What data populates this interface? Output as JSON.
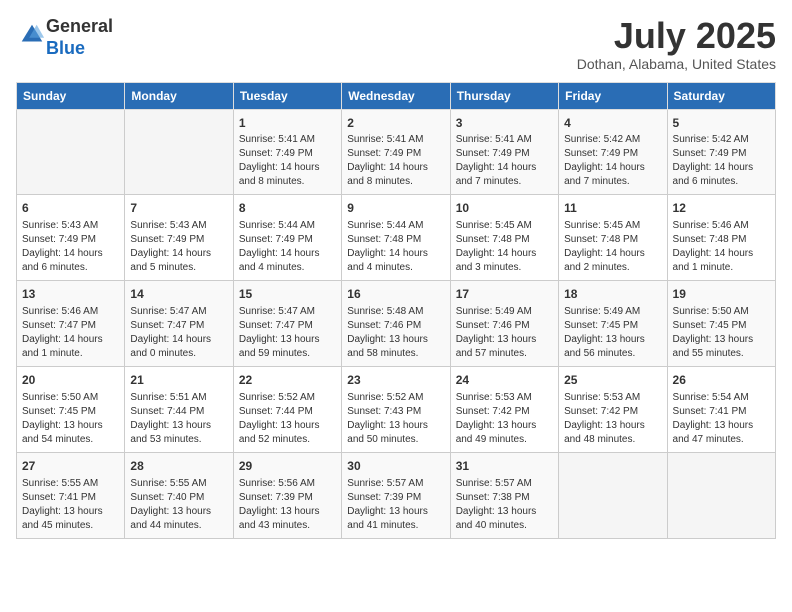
{
  "logo": {
    "general": "General",
    "blue": "Blue"
  },
  "header": {
    "month": "July 2025",
    "location": "Dothan, Alabama, United States"
  },
  "weekdays": [
    "Sunday",
    "Monday",
    "Tuesday",
    "Wednesday",
    "Thursday",
    "Friday",
    "Saturday"
  ],
  "weeks": [
    [
      {
        "day": "",
        "sunrise": "",
        "sunset": "",
        "daylight": ""
      },
      {
        "day": "",
        "sunrise": "",
        "sunset": "",
        "daylight": ""
      },
      {
        "day": "1",
        "sunrise": "Sunrise: 5:41 AM",
        "sunset": "Sunset: 7:49 PM",
        "daylight": "Daylight: 14 hours and 8 minutes."
      },
      {
        "day": "2",
        "sunrise": "Sunrise: 5:41 AM",
        "sunset": "Sunset: 7:49 PM",
        "daylight": "Daylight: 14 hours and 8 minutes."
      },
      {
        "day": "3",
        "sunrise": "Sunrise: 5:41 AM",
        "sunset": "Sunset: 7:49 PM",
        "daylight": "Daylight: 14 hours and 7 minutes."
      },
      {
        "day": "4",
        "sunrise": "Sunrise: 5:42 AM",
        "sunset": "Sunset: 7:49 PM",
        "daylight": "Daylight: 14 hours and 7 minutes."
      },
      {
        "day": "5",
        "sunrise": "Sunrise: 5:42 AM",
        "sunset": "Sunset: 7:49 PM",
        "daylight": "Daylight: 14 hours and 6 minutes."
      }
    ],
    [
      {
        "day": "6",
        "sunrise": "Sunrise: 5:43 AM",
        "sunset": "Sunset: 7:49 PM",
        "daylight": "Daylight: 14 hours and 6 minutes."
      },
      {
        "day": "7",
        "sunrise": "Sunrise: 5:43 AM",
        "sunset": "Sunset: 7:49 PM",
        "daylight": "Daylight: 14 hours and 5 minutes."
      },
      {
        "day": "8",
        "sunrise": "Sunrise: 5:44 AM",
        "sunset": "Sunset: 7:49 PM",
        "daylight": "Daylight: 14 hours and 4 minutes."
      },
      {
        "day": "9",
        "sunrise": "Sunrise: 5:44 AM",
        "sunset": "Sunset: 7:48 PM",
        "daylight": "Daylight: 14 hours and 4 minutes."
      },
      {
        "day": "10",
        "sunrise": "Sunrise: 5:45 AM",
        "sunset": "Sunset: 7:48 PM",
        "daylight": "Daylight: 14 hours and 3 minutes."
      },
      {
        "day": "11",
        "sunrise": "Sunrise: 5:45 AM",
        "sunset": "Sunset: 7:48 PM",
        "daylight": "Daylight: 14 hours and 2 minutes."
      },
      {
        "day": "12",
        "sunrise": "Sunrise: 5:46 AM",
        "sunset": "Sunset: 7:48 PM",
        "daylight": "Daylight: 14 hours and 1 minute."
      }
    ],
    [
      {
        "day": "13",
        "sunrise": "Sunrise: 5:46 AM",
        "sunset": "Sunset: 7:47 PM",
        "daylight": "Daylight: 14 hours and 1 minute."
      },
      {
        "day": "14",
        "sunrise": "Sunrise: 5:47 AM",
        "sunset": "Sunset: 7:47 PM",
        "daylight": "Daylight: 14 hours and 0 minutes."
      },
      {
        "day": "15",
        "sunrise": "Sunrise: 5:47 AM",
        "sunset": "Sunset: 7:47 PM",
        "daylight": "Daylight: 13 hours and 59 minutes."
      },
      {
        "day": "16",
        "sunrise": "Sunrise: 5:48 AM",
        "sunset": "Sunset: 7:46 PM",
        "daylight": "Daylight: 13 hours and 58 minutes."
      },
      {
        "day": "17",
        "sunrise": "Sunrise: 5:49 AM",
        "sunset": "Sunset: 7:46 PM",
        "daylight": "Daylight: 13 hours and 57 minutes."
      },
      {
        "day": "18",
        "sunrise": "Sunrise: 5:49 AM",
        "sunset": "Sunset: 7:45 PM",
        "daylight": "Daylight: 13 hours and 56 minutes."
      },
      {
        "day": "19",
        "sunrise": "Sunrise: 5:50 AM",
        "sunset": "Sunset: 7:45 PM",
        "daylight": "Daylight: 13 hours and 55 minutes."
      }
    ],
    [
      {
        "day": "20",
        "sunrise": "Sunrise: 5:50 AM",
        "sunset": "Sunset: 7:45 PM",
        "daylight": "Daylight: 13 hours and 54 minutes."
      },
      {
        "day": "21",
        "sunrise": "Sunrise: 5:51 AM",
        "sunset": "Sunset: 7:44 PM",
        "daylight": "Daylight: 13 hours and 53 minutes."
      },
      {
        "day": "22",
        "sunrise": "Sunrise: 5:52 AM",
        "sunset": "Sunset: 7:44 PM",
        "daylight": "Daylight: 13 hours and 52 minutes."
      },
      {
        "day": "23",
        "sunrise": "Sunrise: 5:52 AM",
        "sunset": "Sunset: 7:43 PM",
        "daylight": "Daylight: 13 hours and 50 minutes."
      },
      {
        "day": "24",
        "sunrise": "Sunrise: 5:53 AM",
        "sunset": "Sunset: 7:42 PM",
        "daylight": "Daylight: 13 hours and 49 minutes."
      },
      {
        "day": "25",
        "sunrise": "Sunrise: 5:53 AM",
        "sunset": "Sunset: 7:42 PM",
        "daylight": "Daylight: 13 hours and 48 minutes."
      },
      {
        "day": "26",
        "sunrise": "Sunrise: 5:54 AM",
        "sunset": "Sunset: 7:41 PM",
        "daylight": "Daylight: 13 hours and 47 minutes."
      }
    ],
    [
      {
        "day": "27",
        "sunrise": "Sunrise: 5:55 AM",
        "sunset": "Sunset: 7:41 PM",
        "daylight": "Daylight: 13 hours and 45 minutes."
      },
      {
        "day": "28",
        "sunrise": "Sunrise: 5:55 AM",
        "sunset": "Sunset: 7:40 PM",
        "daylight": "Daylight: 13 hours and 44 minutes."
      },
      {
        "day": "29",
        "sunrise": "Sunrise: 5:56 AM",
        "sunset": "Sunset: 7:39 PM",
        "daylight": "Daylight: 13 hours and 43 minutes."
      },
      {
        "day": "30",
        "sunrise": "Sunrise: 5:57 AM",
        "sunset": "Sunset: 7:39 PM",
        "daylight": "Daylight: 13 hours and 41 minutes."
      },
      {
        "day": "31",
        "sunrise": "Sunrise: 5:57 AM",
        "sunset": "Sunset: 7:38 PM",
        "daylight": "Daylight: 13 hours and 40 minutes."
      },
      {
        "day": "",
        "sunrise": "",
        "sunset": "",
        "daylight": ""
      },
      {
        "day": "",
        "sunrise": "",
        "sunset": "",
        "daylight": ""
      }
    ]
  ]
}
